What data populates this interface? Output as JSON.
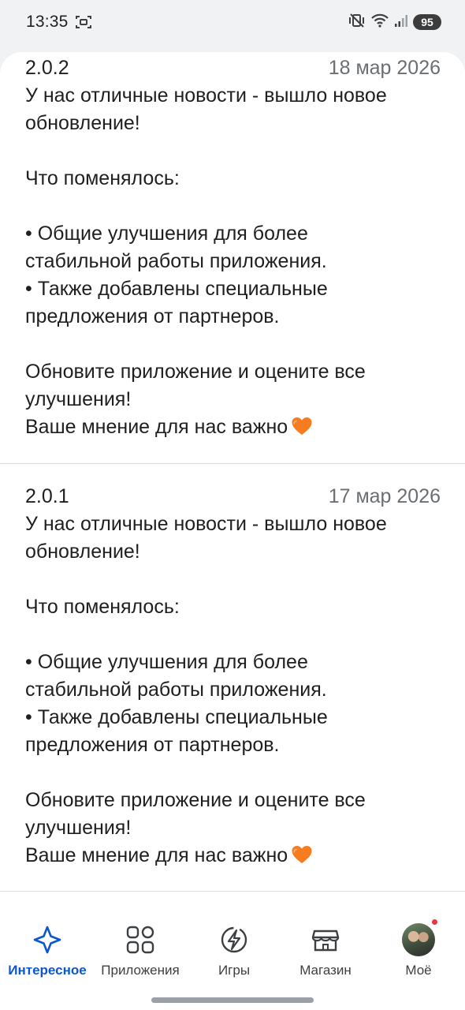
{
  "status_bar": {
    "time": "13:35",
    "battery": "95",
    "icons": [
      "screenshot-icon",
      "mute-vibrate-icon",
      "wifi-icon",
      "signal-icon",
      "battery-icon"
    ]
  },
  "releases": [
    {
      "version": "2.0.2",
      "date": "18 мар 2026",
      "lines": [
        "У нас отличные новости - вышло новое",
        "обновление!",
        "",
        "Что поменялось:",
        "",
        "• Общие улучшения для более",
        "стабильной работы приложения.",
        "• Также добавлены специальные",
        "предложения от партнеров.",
        "",
        "Обновите приложение и оцените все",
        "улучшения!",
        "Ваше мнение для нас важно"
      ]
    },
    {
      "version": "2.0.1",
      "date": "17 мар 2026",
      "lines": [
        "У нас отличные новости - вышло новое",
        "обновление!",
        "",
        "Что поменялось:",
        "",
        "• Общие улучшения для более",
        "стабильной работы приложения.",
        "• Также добавлены специальные",
        "предложения от партнеров.",
        "",
        "Обновите приложение и оцените все",
        "улучшения!",
        "Ваше мнение для нас важно"
      ]
    }
  ],
  "nav": {
    "items": [
      {
        "label": "Интересное",
        "icon": "sparkle-icon",
        "active": true
      },
      {
        "label": "Приложения",
        "icon": "apps-grid-icon",
        "active": false
      },
      {
        "label": "Игры",
        "icon": "games-bolt-icon",
        "active": false
      },
      {
        "label": "Магазин",
        "icon": "store-icon",
        "active": false
      },
      {
        "label": "Моё",
        "icon": "avatar",
        "active": false
      }
    ]
  },
  "colors": {
    "accent": "#0b57d0",
    "heart": "#f57c1f",
    "notification_dot": "#e5393d"
  }
}
